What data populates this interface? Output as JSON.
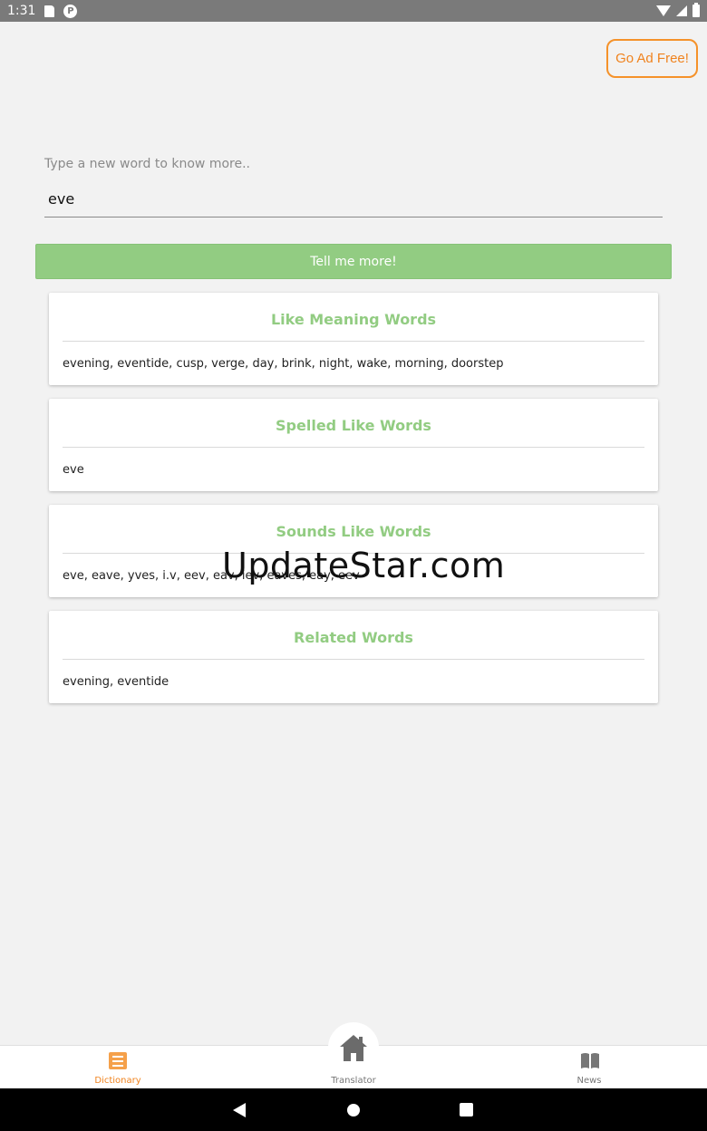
{
  "status_bar": {
    "time": "1:31"
  },
  "header": {
    "ad_free_label": "Go Ad Free!"
  },
  "search": {
    "label": "Type a new word to know more..",
    "value": "eve"
  },
  "submit": {
    "label": "Tell me more!"
  },
  "cards": [
    {
      "title": "Like Meaning Words",
      "body": "evening, eventide, cusp, verge, day, brink, night, wake, morning, doorstep"
    },
    {
      "title": "Spelled Like Words",
      "body": "eve"
    },
    {
      "title": "Sounds Like Words",
      "body": "eve, eave, yves, i.v, eev, eav, iev, eaves, eay, eev"
    },
    {
      "title": "Related Words",
      "body": "evening, eventide"
    }
  ],
  "watermark": "UpdateStar.com",
  "bottom_nav": {
    "dictionary": "Dictionary",
    "translator": "Translator",
    "news": "News"
  },
  "colors": {
    "accent_green": "#92cc82",
    "accent_orange": "#f0831e"
  },
  "icons": [
    "sd-card-icon",
    "p-badge-icon",
    "wifi-icon",
    "signal-icon",
    "battery-icon",
    "list-icon",
    "home-icon",
    "book-icon",
    "back-icon",
    "home-circle-icon",
    "recents-icon"
  ]
}
